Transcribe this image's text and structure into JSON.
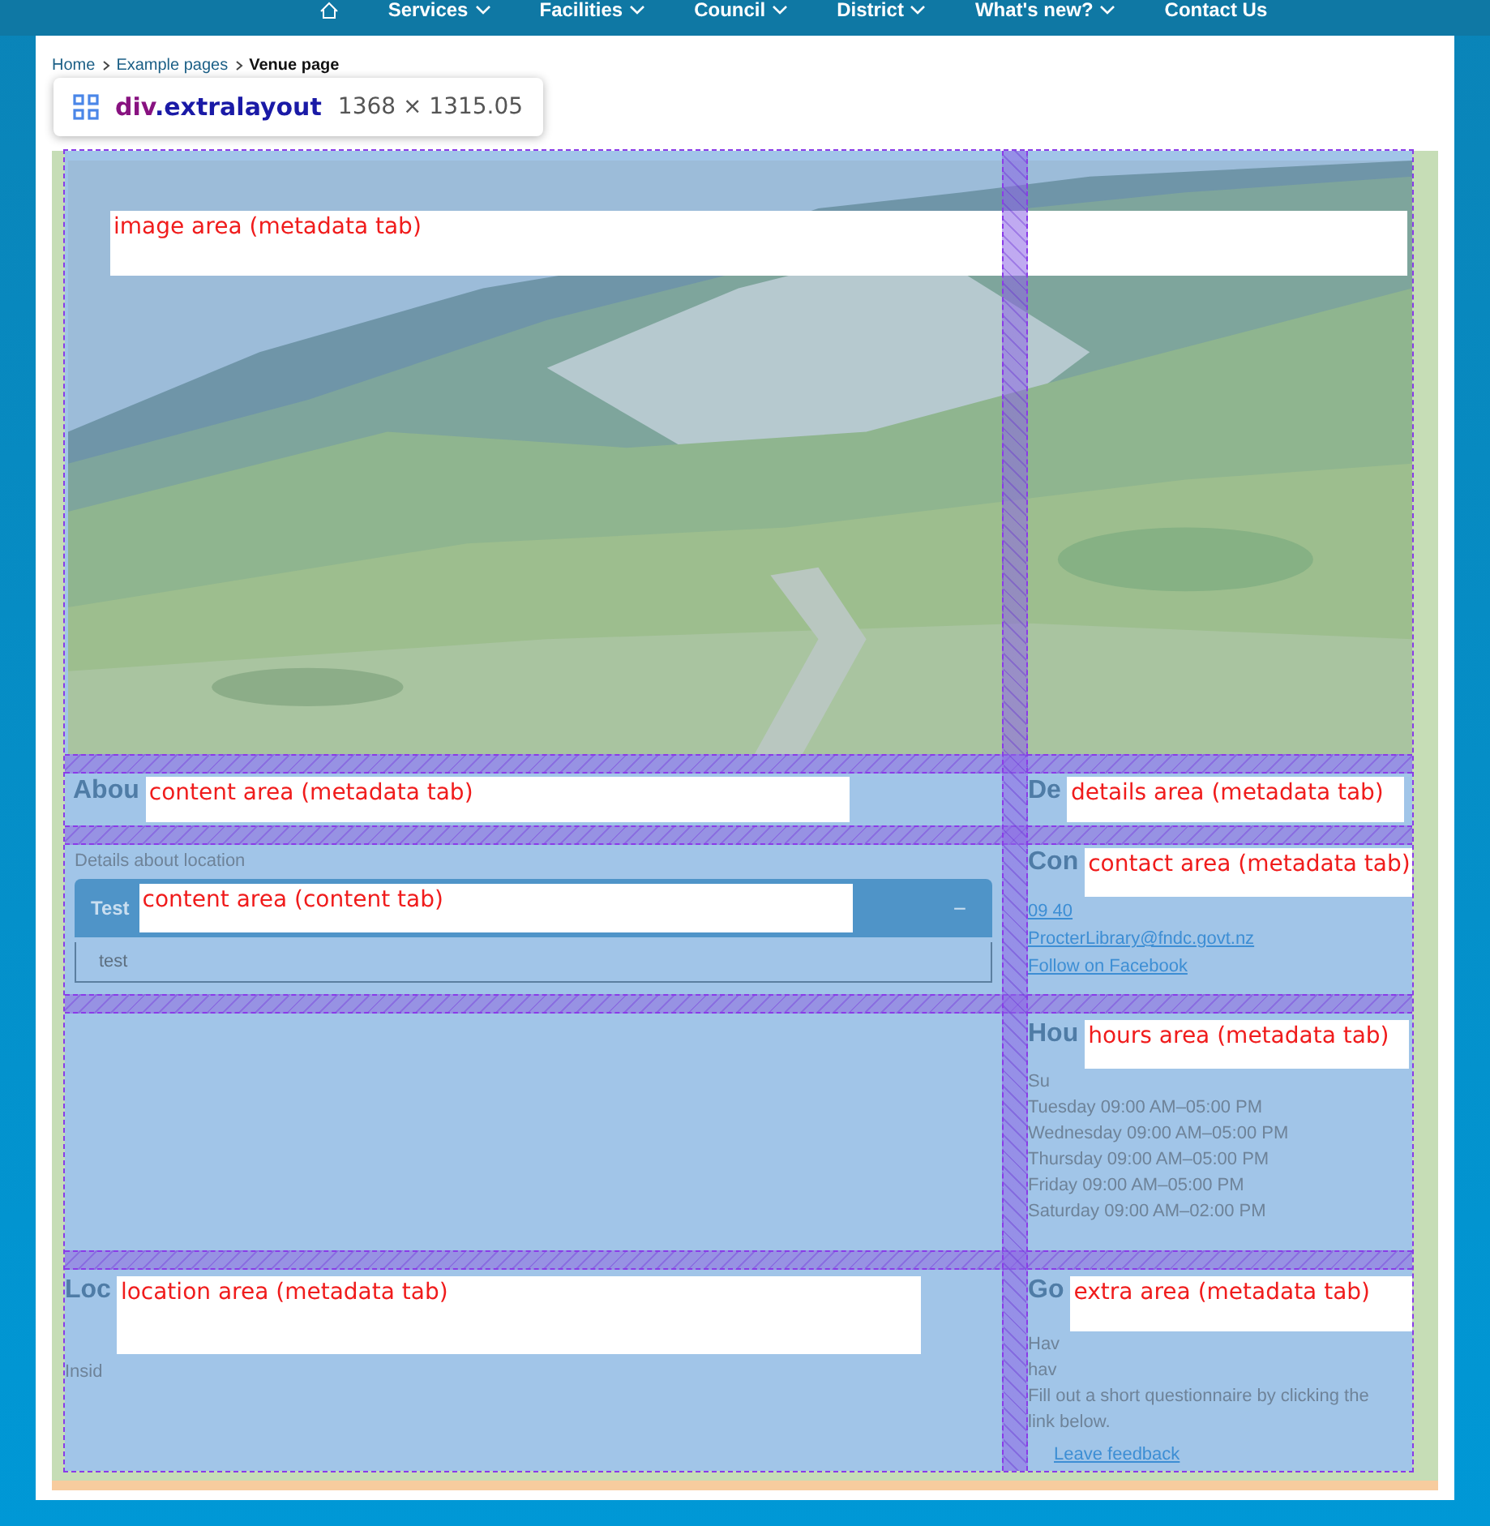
{
  "nav": {
    "items": [
      {
        "label": "Services",
        "dropdown": true
      },
      {
        "label": "Facilities",
        "dropdown": true
      },
      {
        "label": "Council",
        "dropdown": true
      },
      {
        "label": "District",
        "dropdown": true
      },
      {
        "label": "What's new?",
        "dropdown": true
      },
      {
        "label": "Contact Us",
        "dropdown": false
      }
    ]
  },
  "breadcrumb": [
    {
      "label": "Home",
      "current": false
    },
    {
      "label": "Example pages",
      "current": false
    },
    {
      "label": "Venue page",
      "current": true
    }
  ],
  "inspector_tooltip": {
    "tag": "div",
    "class_name": ".extralayout",
    "size": "1368 × 1315.05"
  },
  "layout": {
    "image_area": {
      "label": "image area (metadata tab)"
    },
    "content_heading": {
      "heading": "Abou",
      "label": "content area (metadata tab)"
    },
    "details": {
      "heading": "De",
      "label": "details area (metadata tab)"
    },
    "content": {
      "intro": "Details about location",
      "label": "content area (content tab)",
      "accordion": {
        "title": "Test",
        "toggle": "−",
        "expanded": true,
        "body": "test"
      }
    },
    "contact": {
      "heading": "Con",
      "label": "contact area (metadata tab)",
      "links": [
        "09 40",
        "ProcterLibrary@fndc.govt.nz",
        "Follow on Facebook"
      ]
    },
    "hours": {
      "heading": "Hou",
      "label": "hours area (metadata tab)",
      "lines": [
        "Su",
        "Tuesday 09:00 AM–05:00 PM",
        "Wednesday 09:00 AM–05:00 PM",
        "Thursday 09:00 AM–05:00 PM",
        "Friday 09:00 AM–05:00 PM",
        "Saturday 09:00 AM–02:00 PM"
      ]
    },
    "location": {
      "heading": "Loc",
      "label": "location area (metadata tab)",
      "text": "Insid"
    },
    "extra": {
      "heading": "Go",
      "label": "extra area (metadata tab)",
      "lines": [
        "Hav",
        "hav"
      ],
      "paragraph": "Fill out a short questionnaire by clicking the link below.",
      "link": "Leave feedback"
    }
  }
}
